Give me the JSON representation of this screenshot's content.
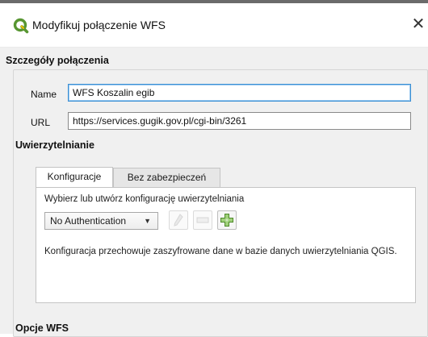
{
  "window": {
    "title": "Modyfikuj połączenie WFS",
    "close_label": "✕"
  },
  "details": {
    "section_title": "Szczegóły połączenia",
    "name_label": "Name",
    "name_value": "WFS Koszalin egib",
    "url_label": "URL",
    "url_value": "https://services.gugik.gov.pl/cgi-bin/3261"
  },
  "auth": {
    "section_title": "Uwierzytelnianie",
    "tabs": [
      {
        "label": "Konfiguracje",
        "active": true
      },
      {
        "label": "Bez zabezpieczeń",
        "active": false
      }
    ],
    "select_prompt": "Wybierz lub utwórz konfigurację uwierzytelniania",
    "config_value": "No Authentication",
    "info_text": "Konfiguracja przechowuje zaszyfrowane dane w bazie danych uwierzytelniania QGIS.",
    "buttons": {
      "edit_icon": "pencil-icon",
      "remove_icon": "minus-icon",
      "add_icon": "plus-icon"
    }
  },
  "wfs_options": {
    "section_title": "Opcje WFS"
  },
  "colors": {
    "qgis_green": "#589632",
    "qgis_yellow": "#eebf00",
    "focus_blue": "#3b8fd4"
  }
}
